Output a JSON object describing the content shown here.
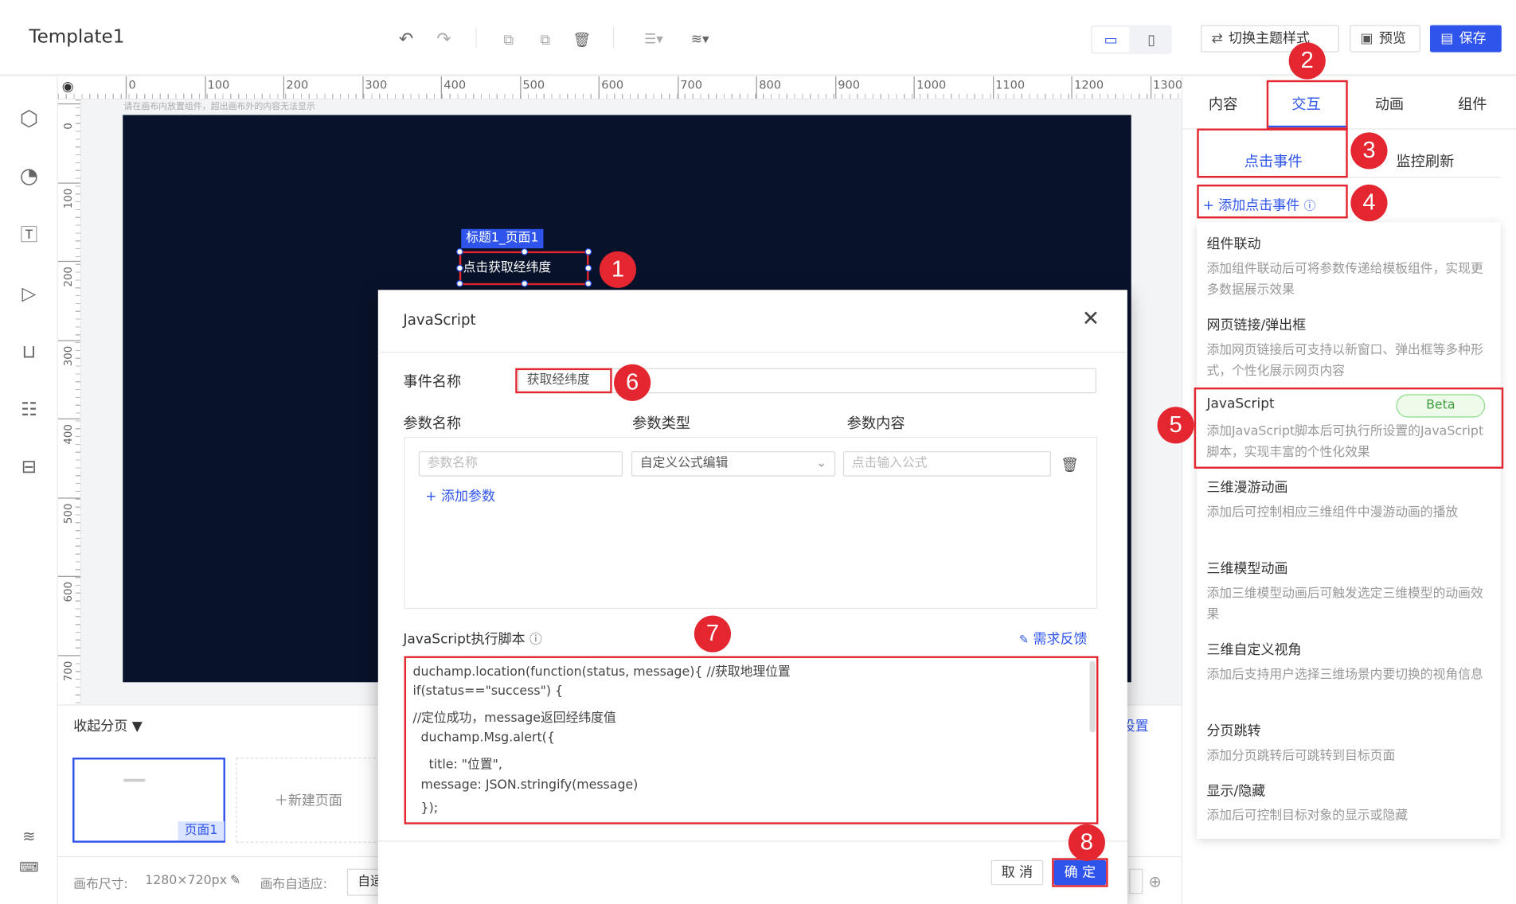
{
  "app": {
    "title": "Template1"
  },
  "toolbar": {
    "theme_label": "切换主题样式",
    "preview_label": "预览",
    "save_label": "保存"
  },
  "ruler": {
    "h_ticks": [
      "0",
      "100",
      "200",
      "300",
      "400",
      "500",
      "600",
      "700",
      "800",
      "900",
      "1000",
      "1100",
      "1200",
      "1300"
    ],
    "v_ticks": [
      "0",
      "100",
      "200",
      "300",
      "400",
      "500",
      "600",
      "700"
    ]
  },
  "canvas": {
    "hint": "请在画布内放置组件，超出画布外的内容无法显示",
    "component_tag": "标题1_页面1",
    "component_text": "点击获取经纬度"
  },
  "pages": {
    "collapse_label": "收起分页",
    "page1_label": "页面1",
    "new_page_label": "新建页面",
    "settings_label": "设置"
  },
  "status": {
    "canvas_size_label": "画布尺寸:",
    "canvas_size_value": "1280×720px",
    "fit_label": "画布自适应:",
    "fit_value": "自适"
  },
  "right_panel": {
    "tabs": [
      "内容",
      "交互",
      "动画",
      "组件"
    ],
    "subtabs": [
      "点击事件",
      "监控刷新"
    ],
    "add_event_label": "+ 添加点击事件",
    "menu": [
      {
        "title": "组件联动",
        "desc": "添加组件联动后可将参数传递给模板组件，实现更多数据展示效果"
      },
      {
        "title": "网页链接/弹出框",
        "desc": "添加网页链接后可支持以新窗口、弹出框等多种形式，个性化展示网页内容"
      },
      {
        "title": "JavaScript",
        "badge": "Beta",
        "desc": "添加JavaScript脚本后可执行所设置的JavaScript脚本，实现丰富的个性化效果"
      },
      {
        "title": "三维漫游动画",
        "desc": "添加后可控制相应三维组件中漫游动画的播放"
      },
      {
        "title": "三维模型动画",
        "desc": "添加三维模型动画后可触发选定三维模型的动画效果"
      },
      {
        "title": "三维自定义视角",
        "desc": "添加后支持用户选择三维场景内要切换的视角信息"
      },
      {
        "title": "分页跳转",
        "desc": "添加分页跳转后可跳转到目标页面"
      },
      {
        "title": "显示/隐藏",
        "desc": "添加后可控制目标对象的显示或隐藏"
      }
    ]
  },
  "modal": {
    "title": "JavaScript",
    "event_name_label": "事件名称",
    "event_name_value": "获取经纬度",
    "param_name_header": "参数名称",
    "param_type_header": "参数类型",
    "param_content_header": "参数内容",
    "param_name_placeholder": "参数名称",
    "param_type_value": "自定义公式编辑",
    "param_content_placeholder": "点击输入公式",
    "add_param_label": "+ 添加参数",
    "script_label": "JavaScript执行脚本",
    "feedback_label": "需求反馈",
    "code_lines": [
      "duchamp.location(function(status, message){ //获取地理位置",
      "if(status==\"success\") {",
      "//定位成功，message返回经纬度值",
      "  duchamp.Msg.alert({",
      "    title: \"位置\",",
      "  message: JSON.stringify(message)",
      "  });"
    ],
    "cancel_label": "取 消",
    "ok_label": "确 定"
  },
  "annotations": [
    "1",
    "2",
    "3",
    "4",
    "5",
    "6",
    "7",
    "8"
  ],
  "colors": {
    "accent": "#2f54eb",
    "highlight": "#e3262f",
    "canvas_bg": "#08122a"
  }
}
